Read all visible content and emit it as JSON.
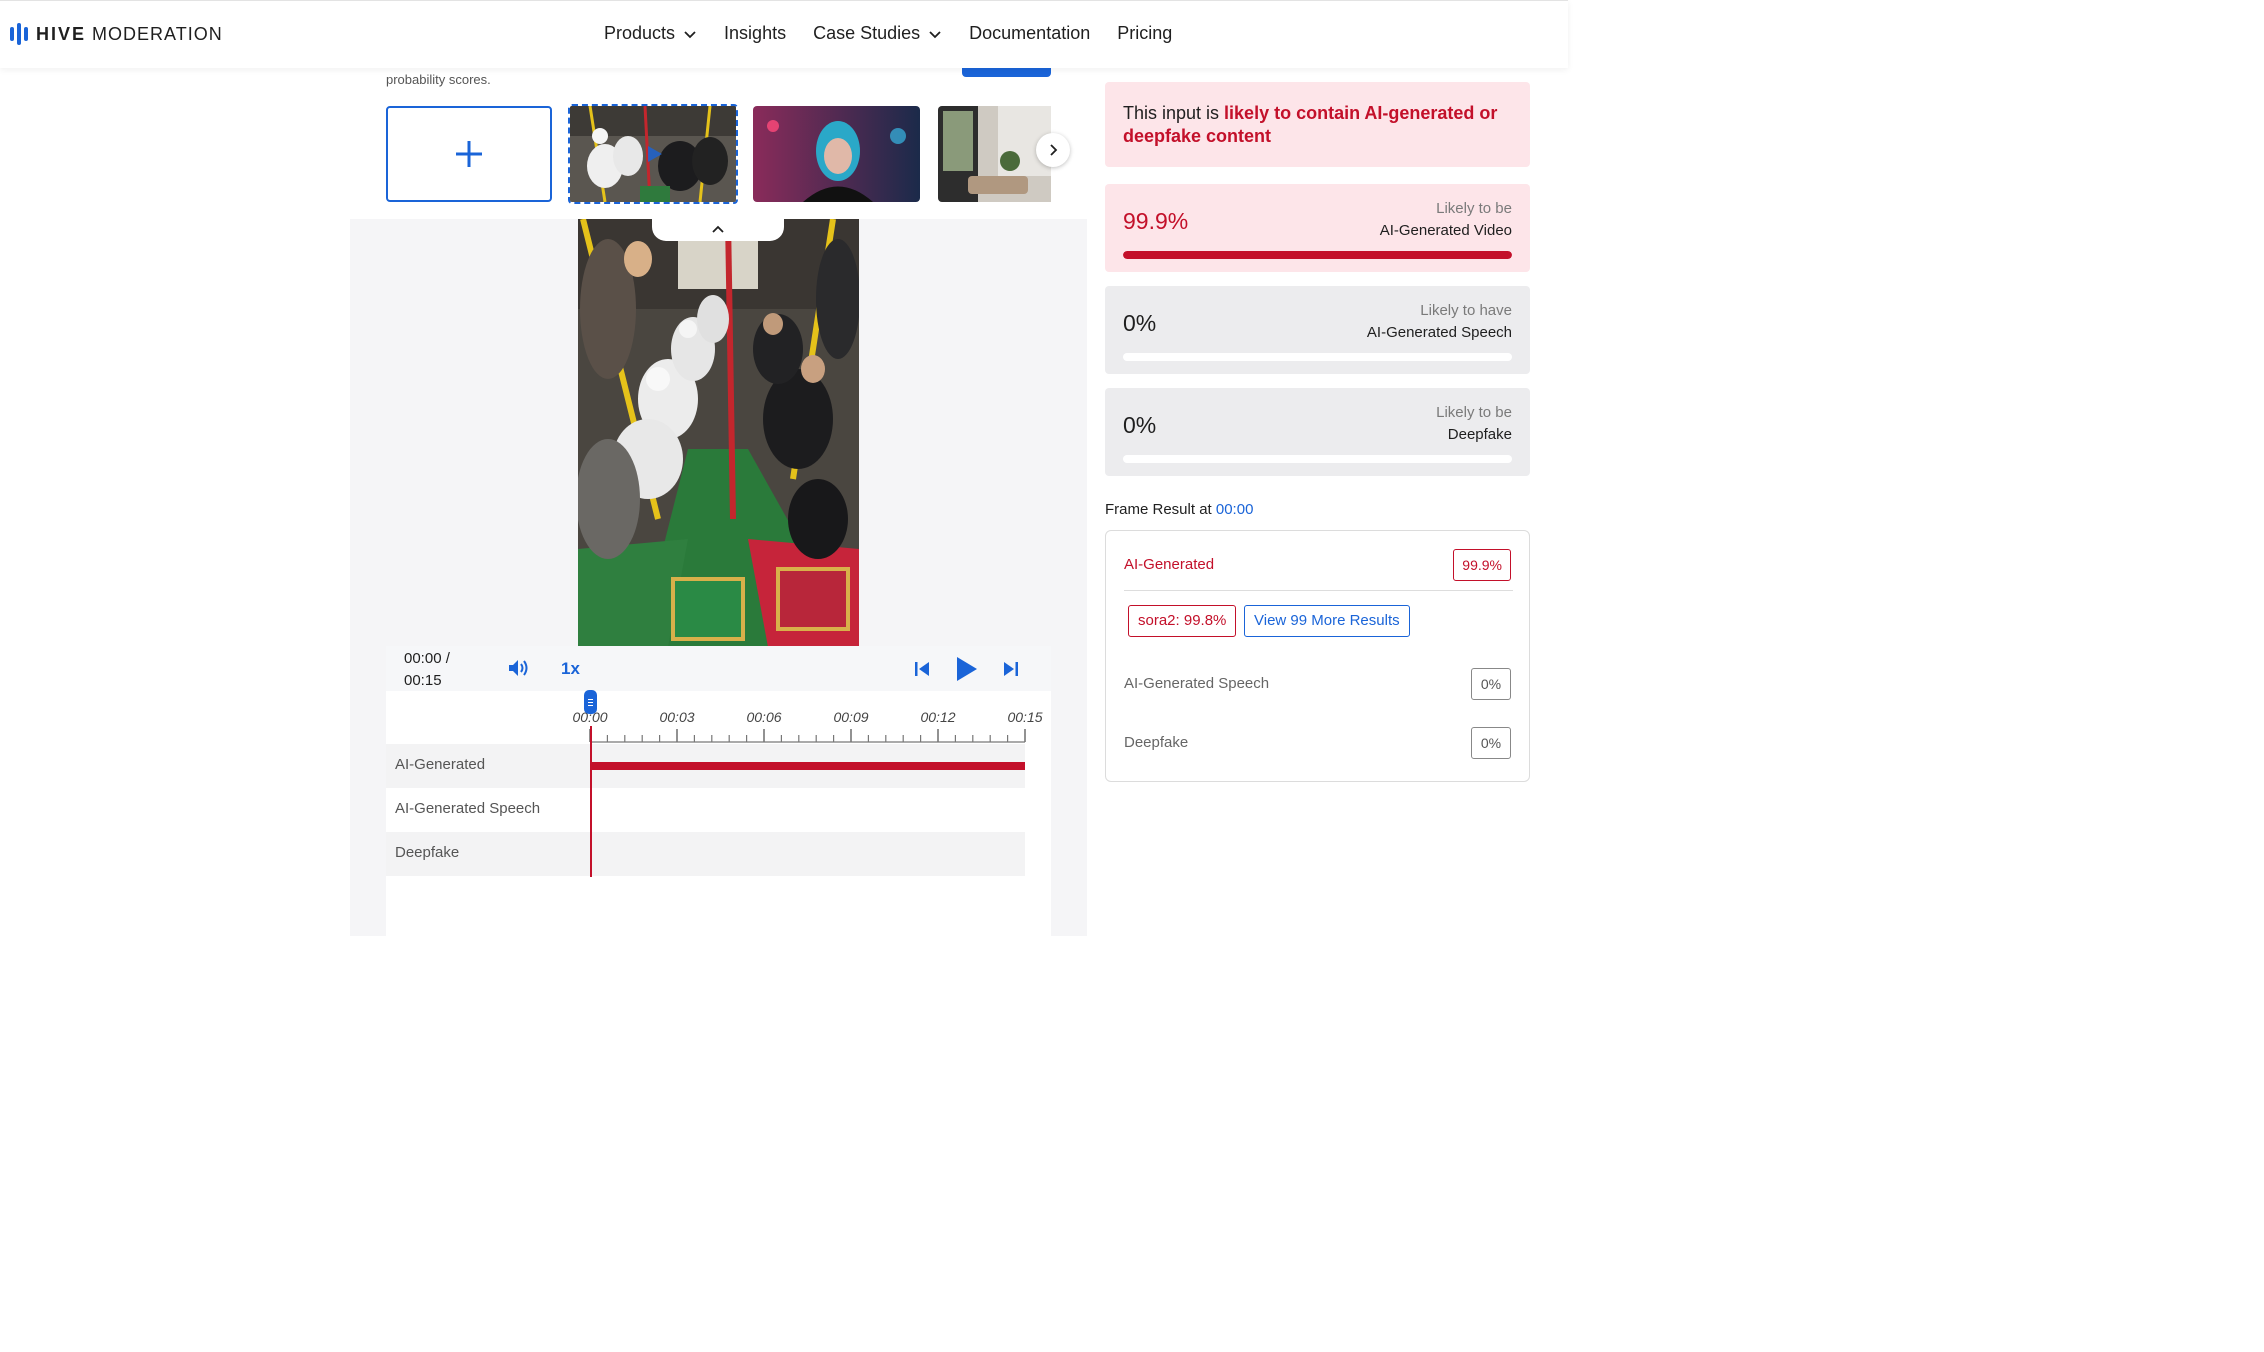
{
  "brand": {
    "name_bold": "HIVE",
    "name_rest": "MODERATION",
    "color": "#1a64d8"
  },
  "nav": {
    "items": [
      "Products",
      "Insights",
      "Case Studies",
      "Documentation",
      "Pricing"
    ]
  },
  "intro": {
    "text": "probability scores."
  },
  "player": {
    "time_current": "00:00 /",
    "time_total": "00:15",
    "speed": "1x",
    "progress_fraction": 0.0,
    "ticks": [
      "00:00",
      "00:03",
      "00:06",
      "00:09",
      "00:12",
      "00:15"
    ],
    "tracks": [
      {
        "label": "AI-Generated",
        "detected": true
      },
      {
        "label": "AI-Generated Speech",
        "detected": false
      },
      {
        "label": "Deepfake",
        "detected": false
      }
    ]
  },
  "verdict": {
    "prefix": "This input is ",
    "highlight": "likely to contain AI-generated or deepfake content"
  },
  "scores": {
    "ai_video": {
      "pct": "99.9%",
      "line1": "Likely to be",
      "line2": "AI-Generated Video",
      "fraction": 0.999
    },
    "ai_speech": {
      "pct": "0%",
      "line1": "Likely to have",
      "line2": "AI-Generated Speech",
      "fraction": 0
    },
    "deepfake": {
      "pct": "0%",
      "line1": "Likely to be",
      "line2": "Deepfake",
      "fraction": 0
    }
  },
  "frame_result": {
    "title": "Frame Result at ",
    "time": "00:00",
    "ai_label": "AI-Generated",
    "ai_value": "99.9%",
    "model_chip": "sora2: 99.8%",
    "more_button": "View 99 More Results",
    "speech_label": "AI-Generated Speech",
    "speech_value": "0%",
    "deepfake_label": "Deepfake",
    "deepfake_value": "0%"
  },
  "colors": {
    "accent": "#1a64d8",
    "alert": "#c3102a",
    "alert_bg": "#fde5e9"
  }
}
